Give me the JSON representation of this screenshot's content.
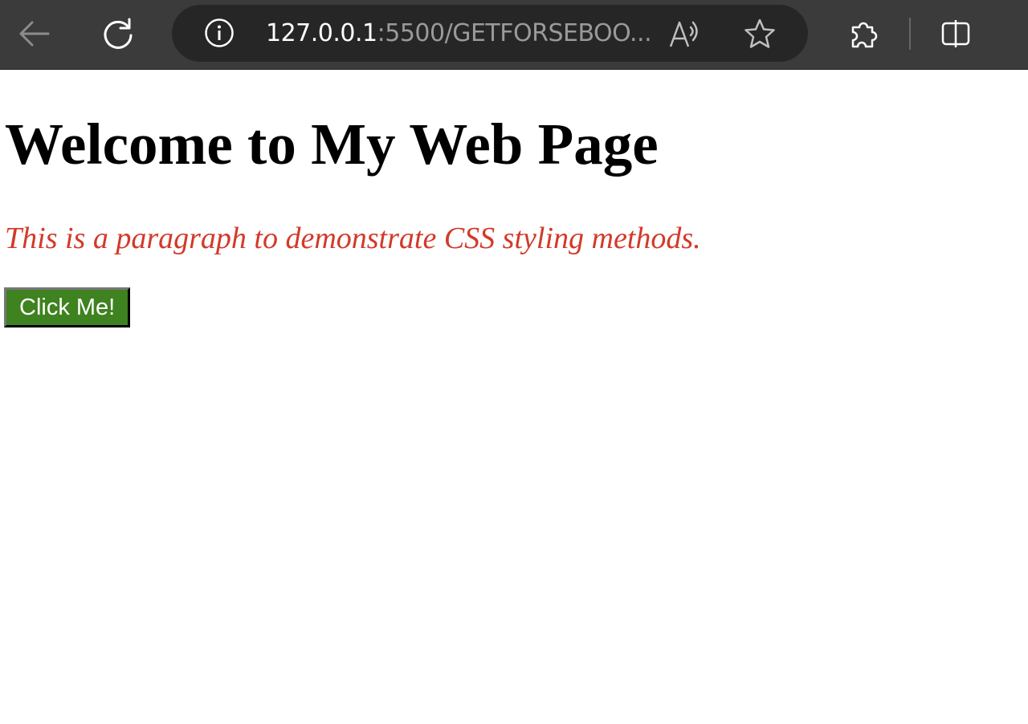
{
  "browser": {
    "url_host": "127.0.0.1",
    "url_rest": ":5500/GETFORSEBOO...",
    "icons": {
      "back": "back-arrow-icon",
      "reload": "reload-icon",
      "info": "info-icon",
      "read_aloud": "read-aloud-icon",
      "favorite": "star-icon",
      "extensions": "puzzle-icon",
      "split_screen": "split-screen-icon"
    }
  },
  "page": {
    "heading": "Welcome to My Web Page",
    "paragraph": "This is a paragraph to demonstrate CSS styling methods.",
    "button_label": "Click Me!"
  },
  "colors": {
    "toolbar_bg": "#3b3b3b",
    "addressbar_bg": "#262626",
    "paragraph_text": "#d23a2a",
    "button_bg": "#3f8220"
  }
}
